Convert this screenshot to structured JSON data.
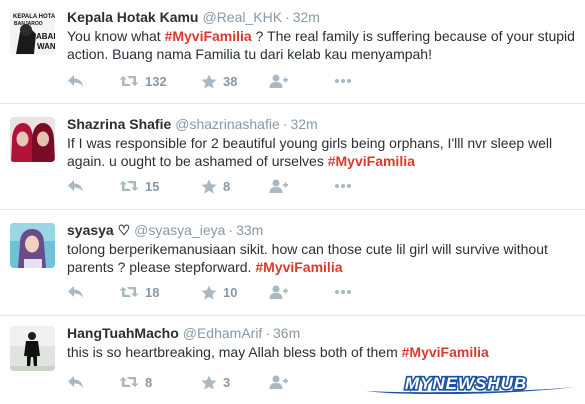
{
  "tweets": [
    {
      "fullname": "Kepala Hotak Kamu",
      "username": "@Real_KHK",
      "separator": "·",
      "time": "32m",
      "text_before": "You know what ",
      "hashtag": "#MyviFamilia",
      "text_after": " ? The real family is suffering because of your stupid action. Buang nama Familia tu dari kelab kau menyampah!",
      "retweets": "132",
      "favorites": "38",
      "avatar_text": [
        "KEPALA HOTAK",
        "BANJAROO",
        "ABAH",
        "WAN"
      ]
    },
    {
      "fullname": "Shazrina Shafie",
      "username": "@shazrinashafie",
      "separator": "·",
      "time": "32m",
      "text_before": "If I was responsible for 2 beautiful young girls being orphans, I'lll nvr sleep well again. u ought to be ashamed of urselves ",
      "hashtag": "#MyviFamilia",
      "text_after": "",
      "retweets": "15",
      "favorites": "8"
    },
    {
      "fullname": "syasya ♡",
      "username": "@syasya_ieya",
      "separator": "·",
      "time": "33m",
      "text_before": "tolong berperikemanusiaan sikit. how can those cute lil girl will survive without parents ? please stepforward. ",
      "hashtag": "#MyviFamilia",
      "text_after": "",
      "retweets": "18",
      "favorites": "10"
    },
    {
      "fullname": "HangTuahMacho",
      "username": "@EdhamArif",
      "separator": "·",
      "time": "36m",
      "text_before": "this is so heartbreaking, may Allah bless both of them ",
      "hashtag": "#MyviFamilia",
      "text_after": "",
      "retweets": "8",
      "favorites": "3"
    }
  ],
  "watermark": "MYNEWSHUB",
  "icons": {
    "reply": "reply-icon",
    "retweet": "retweet-icon",
    "favorite": "star-icon",
    "follow": "follow-icon",
    "more": "more-dots-icon"
  },
  "colors": {
    "hashtag": "#d93a2b",
    "meta": "#8899a6",
    "action": "#aab8c2",
    "watermark": "#1b4fa3"
  }
}
